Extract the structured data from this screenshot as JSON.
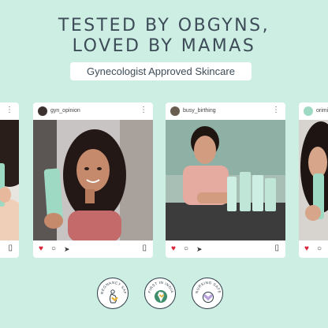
{
  "headline": {
    "line1": "TESTED BY OBGYNS,",
    "line2": "LOVED BY MAMAS"
  },
  "subheading": "Gynecologist Approved Skincare",
  "posts": [
    {
      "handle": "",
      "visible": "partial-left"
    },
    {
      "handle": "gyn_opinion"
    },
    {
      "handle": "busy_birthing"
    },
    {
      "handle": "orimi",
      "visible": "partial-right"
    }
  ],
  "badges": [
    {
      "text": "PREGNANCY SAFE",
      "icon": "pregnant-woman-icon"
    },
    {
      "text": "FIRST IN INDIA",
      "icon": "india-map-icon"
    },
    {
      "text": "NURSING SAFE",
      "icon": "heart-icon"
    }
  ],
  "colors": {
    "background": "#cdeee2",
    "text": "#3d4c58",
    "heart": "#d8223a",
    "product_tube": "#9ed9c3",
    "badge_heart": "#e9b33a",
    "badge_heart2": "#b9a2dc"
  }
}
